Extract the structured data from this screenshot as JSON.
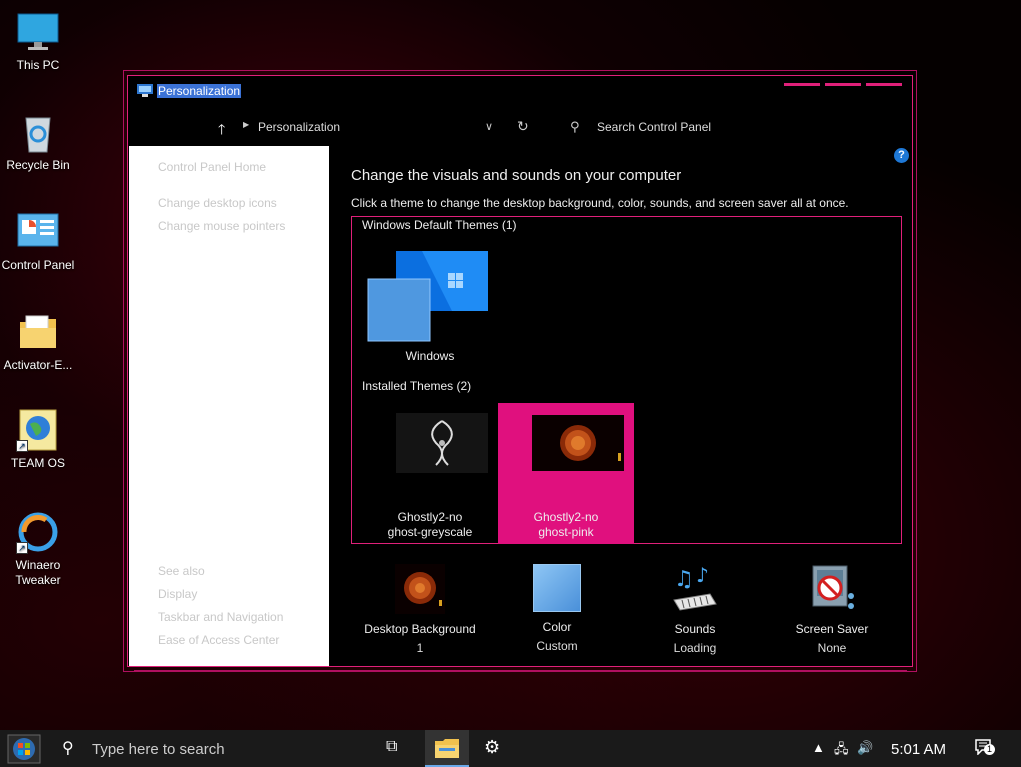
{
  "desktop": {
    "icons": [
      {
        "label": "This PC"
      },
      {
        "label": "Recycle Bin"
      },
      {
        "label": "Control Panel"
      },
      {
        "label": "Activator-E..."
      },
      {
        "label": "TEAM OS"
      },
      {
        "label": "Winaero Tweaker"
      }
    ]
  },
  "window": {
    "title": "Personalization",
    "breadcrumb": "Personalization",
    "search_placeholder": "Search Control Panel",
    "help": "?"
  },
  "sidebar": {
    "home": "Control Panel Home",
    "links": [
      "Change desktop icons",
      "Change mouse pointers"
    ],
    "see_also_heading": "See also",
    "see_also": [
      "Display",
      "Taskbar and Navigation",
      "Ease of Access Center"
    ]
  },
  "main": {
    "title": "Change the visuals and sounds on your computer",
    "subtitle": "Click a theme to change the desktop background, color, sounds, and screen saver all at once.",
    "groups": [
      {
        "label": "Windows Default Themes (1)",
        "themes": [
          {
            "name": "Windows"
          }
        ]
      },
      {
        "label": "Installed Themes (2)",
        "themes": [
          {
            "name_line1": "Ghostly2-no",
            "name_line2": "ghost-greyscale"
          },
          {
            "name_line1": "Ghostly2-no",
            "name_line2": "ghost-pink",
            "selected": true
          }
        ]
      }
    ],
    "bottom": [
      {
        "label": "Desktop Background",
        "value": "1"
      },
      {
        "label": "Color",
        "value": "Custom"
      },
      {
        "label": "Sounds",
        "value": "Loading"
      },
      {
        "label": "Screen Saver",
        "value": "None"
      }
    ]
  },
  "taskbar": {
    "search_placeholder": "Type here to search",
    "time": "5:01 AM",
    "notification_count": "1"
  },
  "colors": {
    "accent": "#e0107e",
    "selection": "#3b72d6"
  }
}
